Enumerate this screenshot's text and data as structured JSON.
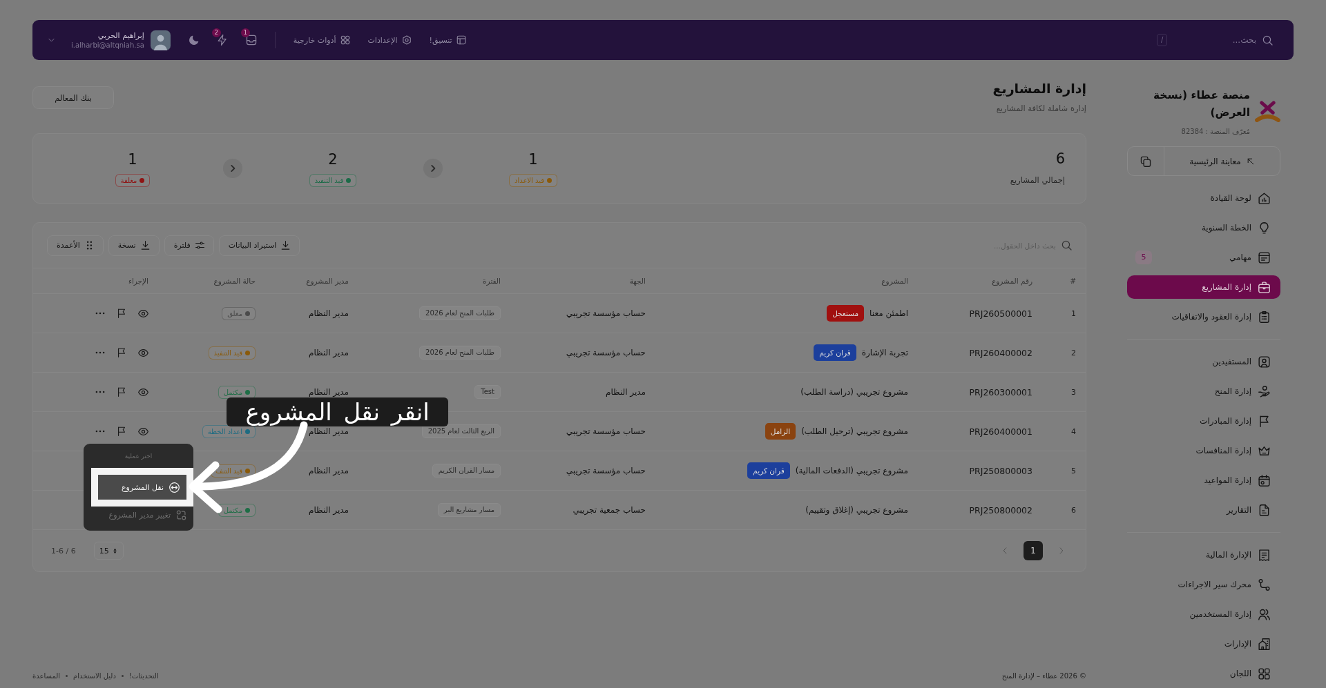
{
  "topbar": {
    "search": {
      "placeholder": "بحث..."
    },
    "shortcut": "/",
    "links": [
      {
        "label": "تنسيق!"
      },
      {
        "label": "الإعدادات"
      },
      {
        "label": "أدوات خارجية"
      }
    ],
    "alerts": [
      {
        "count": "1"
      },
      {
        "count": "2"
      }
    ],
    "user": {
      "name": "إبراهيم الحربي",
      "email": "i.alharbi@altqniah.sa"
    }
  },
  "sidebar": {
    "title": "منصة عطاء (نسخة العرض)",
    "platform_id": "مُعرّف المنصة : 82384",
    "preview": "معاينة الرئيسية",
    "groups": [
      {
        "items": [
          {
            "label": "لوحة القيادة",
            "selected": false
          },
          {
            "label": "الخطة السنوية",
            "selected": false
          },
          {
            "label": "مهامي",
            "selected": false,
            "badge": "5"
          },
          {
            "label": "إدارة المشاريع",
            "selected": true
          },
          {
            "label": "إدارة العقود والاتفاقيات",
            "selected": false
          }
        ]
      },
      {
        "items": [
          {
            "label": "المستفيدين",
            "selected": false
          },
          {
            "label": "إدارة المنح",
            "selected": false
          },
          {
            "label": "إدارة المبادرات",
            "selected": false
          },
          {
            "label": "إدارة المنافسات",
            "selected": false
          },
          {
            "label": "إدارة المواعيد",
            "selected": false
          },
          {
            "label": "التقارير",
            "selected": false
          }
        ]
      },
      {
        "items": [
          {
            "label": "الإدارة المالية",
            "selected": false
          },
          {
            "label": "محرك سير الاجراءات",
            "selected": false
          },
          {
            "label": "إدارة المستخدمين",
            "selected": false
          },
          {
            "label": "الإدارات",
            "selected": false
          },
          {
            "label": "اللجان",
            "selected": false
          }
        ]
      }
    ]
  },
  "header": {
    "title": "إدارة المشاريع",
    "subtitle": "إدارة شاملة لكافة المشاريع",
    "action": "بنك المعالم"
  },
  "stats": {
    "total": {
      "value": "6",
      "label": "إجمالي المشاريع"
    },
    "items": [
      {
        "value": "1",
        "label": "قيد الاعداد",
        "color": "#8c5a08"
      },
      {
        "value": "2",
        "label": "قيد التنفيذ",
        "color": "#1c6b48"
      },
      {
        "value": "1",
        "label": "مغلقة",
        "color": "#8f1414"
      }
    ]
  },
  "table": {
    "search": {
      "placeholder": "بحث داخل الحقول..."
    },
    "tools": [
      {
        "label": "استيراد البيانات"
      },
      {
        "label": "فلترة"
      },
      {
        "label": "نسخة"
      },
      {
        "label": "الأعمدة"
      }
    ],
    "columns": [
      "#",
      "رقم المشروع",
      "المشروع",
      "الجهة",
      "الفترة",
      "مدير المشروع",
      "حالة المشروع",
      "الإجراء"
    ],
    "rows": [
      {
        "index": "1",
        "number": "PRJ260500001",
        "project": "اطمئن معنا",
        "tag": {
          "label": "مستعجل",
          "color": "#a0100f"
        },
        "entity": "حساب مؤسسة تجريبي",
        "period": "طلبات المنح لعام 2026",
        "manager": "مدير النظام",
        "status": {
          "label": "مغلق",
          "color": "#4b4b4b"
        },
        "actions": true
      },
      {
        "index": "2",
        "number": "PRJ260400002",
        "project": "تجربة الإشارة",
        "tag": {
          "label": "قران كريم",
          "color": "#1c3f9c"
        },
        "entity": "حساب مؤسسة تجريبي",
        "period": "طلبات المنح لعام 2026",
        "manager": "مدير النظام",
        "status": {
          "label": "قيد التنفيذ",
          "color": "#8a5a0a"
        },
        "actions": true
      },
      {
        "index": "3",
        "number": "PRJ260300001",
        "project": "مشروع تجريبي (دراسة الطلب)",
        "entity": "مدير النظام",
        "period": "Test",
        "manager": "مدير النظام",
        "status": {
          "label": "مكتمل",
          "color": "#1e6e46"
        },
        "actions": true
      },
      {
        "index": "4",
        "number": "PRJ260400001",
        "project": "مشروع تجريبي (ترحيل الطلب)",
        "tag": {
          "label": "الزامل",
          "color": "#8a4310"
        },
        "entity": "حساب مؤسسة تجريبي",
        "period": "الربع الثالث لعام 2025",
        "manager": "مدير النظام",
        "status": {
          "label": "اعداد الخطة",
          "color": "#1e6c82"
        },
        "actions": true
      },
      {
        "index": "5",
        "number": "PRJ250800003",
        "project": "مشروع تجريبي (الدفعات المالية)",
        "tag": {
          "label": "قران كريم",
          "color": "#1c3f9c"
        },
        "entity": "حساب مؤسسة تجريبي",
        "period": "مسار القران الكريم",
        "manager": "مدير النظام",
        "status": {
          "label": "قيد التنف",
          "color": "#8a5a0a"
        }
      },
      {
        "index": "6",
        "number": "PRJ250800002",
        "project": "مشروع تجريبي (إغلاق وتقييم)",
        "entity": "حساب جمعية تجريبي",
        "period": "مسار مشاريع البر",
        "manager": "مدير النظام",
        "status": {
          "label": "مكتمل",
          "color": "#1e6e46"
        }
      }
    ],
    "pagination": {
      "range": "1-6 / 6",
      "page_size": "15",
      "pages": [
        {
          "label": "1",
          "selected": true
        }
      ]
    }
  },
  "footer": {
    "copyright": "© 2026 عطاء – لإدارة المنح",
    "links": [
      {
        "label": "التحديثات!"
      },
      {
        "label": "دليل الاستخدام"
      },
      {
        "label": "المساعدة"
      }
    ]
  },
  "action_menu": {
    "title": "اختر عملية",
    "items": [
      {
        "label": "نقل المشروع",
        "selected": true
      },
      {
        "label": "تغيير مدير المشروع",
        "selected": false
      }
    ]
  },
  "callout": {
    "text": "انقر نقل المشروع"
  }
}
